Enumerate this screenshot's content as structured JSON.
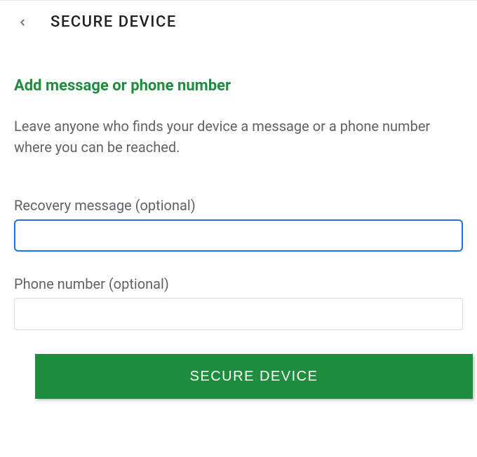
{
  "header": {
    "title": "SECURE DEVICE"
  },
  "section": {
    "title": "Add message or phone number",
    "description": "Leave anyone who finds your device a message or a phone number where you can be reached."
  },
  "fields": {
    "recovery": {
      "label": "Recovery message (optional)",
      "value": ""
    },
    "phone": {
      "label": "Phone number (optional)",
      "value": ""
    }
  },
  "actions": {
    "secure_button_label": "SECURE DEVICE"
  },
  "colors": {
    "accent_green": "#1e8e3e",
    "focus_blue": "#1a73e8",
    "text_primary": "#202124",
    "text_secondary": "#5f6368"
  }
}
